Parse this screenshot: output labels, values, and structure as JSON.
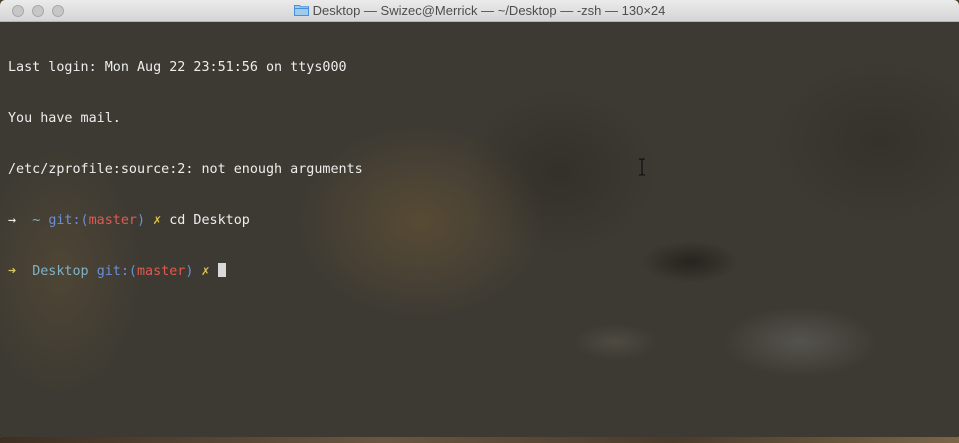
{
  "window": {
    "title": "Desktop — Swizec@Merrick — ~/Desktop — -zsh — 130×24",
    "title_icon": "folder-icon"
  },
  "terminal": {
    "line1": "Last login: Mon Aug 22 23:51:56 on ttys000",
    "line2": "You have mail.",
    "line3": "/etc/zprofile:source:2: not enough arguments",
    "prompt1": {
      "arrow": "→",
      "dir": "~",
      "git_prefix": "git:(",
      "branch": "master",
      "git_suffix": ")",
      "dirty": "✗",
      "command": "cd Desktop"
    },
    "prompt2": {
      "arrow": "➜",
      "dir": "Desktop",
      "git_prefix": "git:(",
      "branch": "master",
      "git_suffix": ")",
      "dirty": "✗"
    }
  },
  "colors": {
    "prompt_arrow": "#d8c65a",
    "dir": "#7fb3c9",
    "git": "#6a8fd6",
    "branch": "#e05a52",
    "dirty": "#e5c24a",
    "text": "#ededed"
  }
}
